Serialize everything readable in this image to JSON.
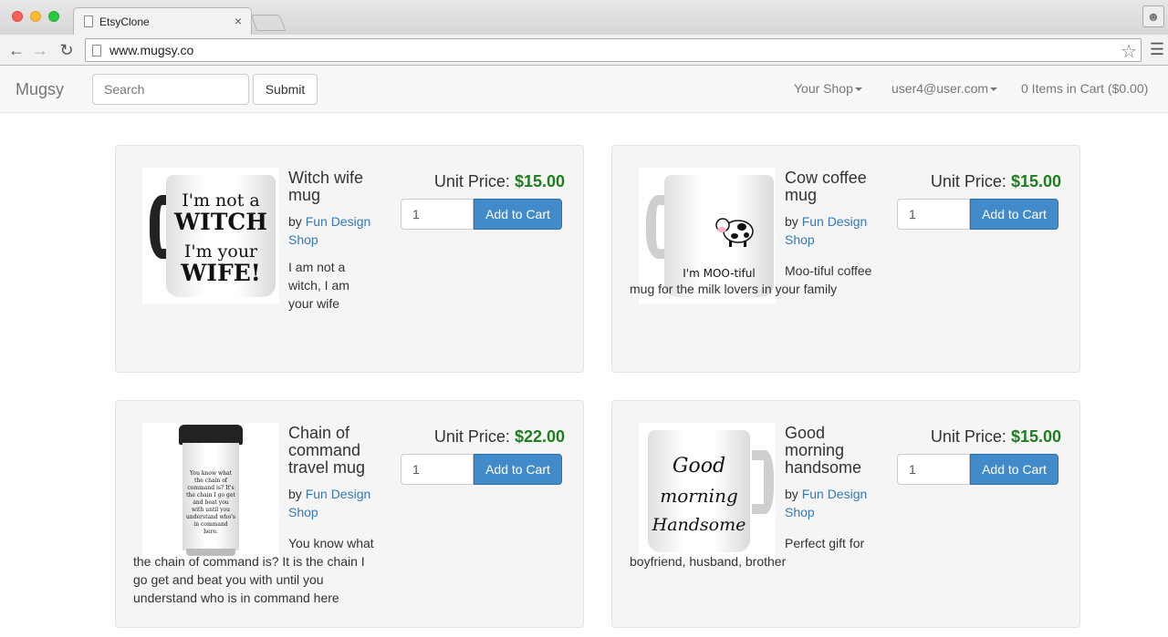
{
  "browser": {
    "tab_title": "EtsyClone",
    "tab_close": "×",
    "url": "www.mugsy.co"
  },
  "navbar": {
    "brand": "Mugsy",
    "search_placeholder": "Search",
    "submit_label": "Submit",
    "your_shop": "Your Shop",
    "user_email": "user4@user.com",
    "cart": "0 Items in Cart ($0.00)"
  },
  "colors": {
    "price_green": "#1e7e1e",
    "link_blue": "#337ab7",
    "button_blue": "#428bca"
  },
  "products": [
    {
      "title": "Witch wife mug",
      "by_prefix": "by",
      "shop": "Fun Design Shop",
      "description": "I am not a witch, I am your wife",
      "price_label": "Unit Price:",
      "price": "$15.00",
      "quantity": "1",
      "add_label": "Add to Cart",
      "image_text": [
        "I'm not a",
        "WITCH",
        "I'm your",
        "WIFE!"
      ]
    },
    {
      "title": "Cow coffee mug",
      "by_prefix": "by",
      "shop": "Fun Design Shop",
      "description": "Moo-tiful coffee mug for the milk lovers in your family",
      "price_label": "Unit Price:",
      "price": "$15.00",
      "quantity": "1",
      "add_label": "Add to Cart",
      "image_text": [
        "I'm MOO-tiful"
      ]
    },
    {
      "title": "Chain of command travel mug",
      "by_prefix": "by",
      "shop": "Fun Design Shop",
      "description": "You know what the chain of command is? It is the chain I go get and beat you with until you understand who is in command here",
      "price_label": "Unit Price:",
      "price": "$22.00",
      "quantity": "1",
      "add_label": "Add to Cart",
      "image_text": [
        "You know what the chain of command is? It's the chain I go get and beat you with until you understand who's in command here."
      ]
    },
    {
      "title": "Good morning handsome",
      "by_prefix": "by",
      "shop": "Fun Design Shop",
      "description": "Perfect gift for boyfriend, husband, brother",
      "price_label": "Unit Price:",
      "price": "$15.00",
      "quantity": "1",
      "add_label": "Add to Cart",
      "image_text": [
        "Good",
        "morning",
        "Handsome"
      ]
    }
  ]
}
